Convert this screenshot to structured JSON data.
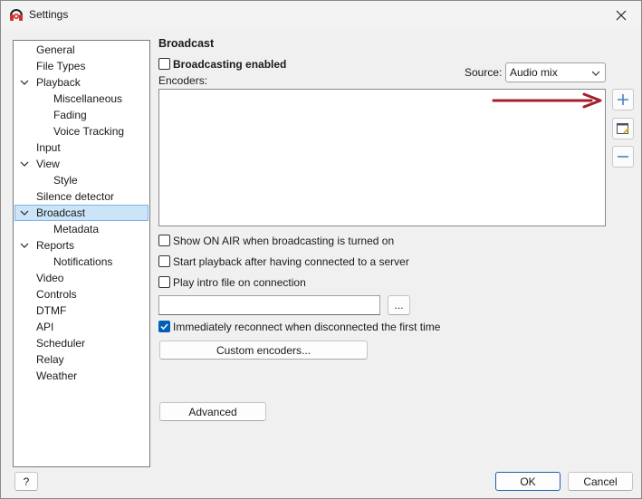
{
  "window": {
    "title": "Settings"
  },
  "tree": {
    "items": [
      {
        "label": "General"
      },
      {
        "label": "File Types"
      },
      {
        "label": "Playback"
      },
      {
        "label": "Miscellaneous"
      },
      {
        "label": "Fading"
      },
      {
        "label": "Voice Tracking"
      },
      {
        "label": "Input"
      },
      {
        "label": "View"
      },
      {
        "label": "Style"
      },
      {
        "label": "Silence detector"
      },
      {
        "label": "Broadcast"
      },
      {
        "label": "Metadata"
      },
      {
        "label": "Reports"
      },
      {
        "label": "Notifications"
      },
      {
        "label": "Video"
      },
      {
        "label": "Controls"
      },
      {
        "label": "DTMF"
      },
      {
        "label": "API"
      },
      {
        "label": "Scheduler"
      },
      {
        "label": "Relay"
      },
      {
        "label": "Weather"
      }
    ],
    "selected": "Broadcast"
  },
  "panel": {
    "title": "Broadcast",
    "broadcasting_enabled": {
      "label": "Broadcasting enabled",
      "checked": false
    },
    "source": {
      "label": "Source:",
      "value": "Audio mix"
    },
    "encoders_label": "Encoders:",
    "encoder_items": [],
    "options": {
      "show_on_air": {
        "label": "Show ON AIR when broadcasting is turned on",
        "checked": false
      },
      "start_playback": {
        "label": "Start playback after having connected to a server",
        "checked": false
      },
      "play_intro": {
        "label": "Play intro file on connection",
        "checked": false
      },
      "reconnect": {
        "label": "Immediately reconnect when disconnected the first time",
        "checked": true
      }
    },
    "intro_file": {
      "value": ""
    },
    "browse_label": "...",
    "custom_encoders_label": "Custom encoders...",
    "advanced_label": "Advanced"
  },
  "footer": {
    "help_label": "?",
    "ok_label": "OK",
    "cancel_label": "Cancel"
  },
  "colors": {
    "accent": "#005fb8",
    "arrow": "#a31f2a",
    "selection": "#cce4f7"
  }
}
